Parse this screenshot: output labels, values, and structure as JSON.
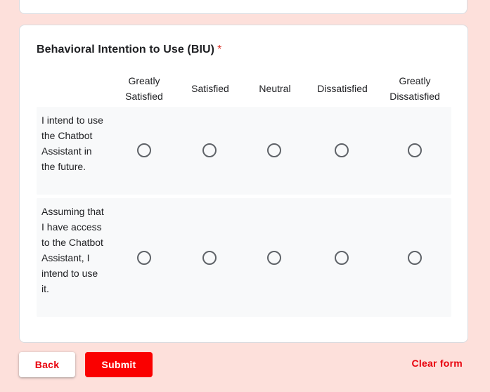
{
  "colors": {
    "page_background": "#fde0db",
    "card_background": "#ffffff",
    "row_background": "#f8f9fa",
    "required_asterisk": "#d93025",
    "accent": "#fa0000",
    "radio_border": "#5f6368"
  },
  "question": {
    "title": "Behavioral Intention to Use (BIU)",
    "required_marker": "*",
    "columns": [
      "Greatly Satisfied",
      "Satisfied",
      "Neutral",
      "Dissatisfied",
      "Greatly Dissatisfied"
    ],
    "rows": [
      {
        "label": "I intend to use the Chatbot Assistant in the future.",
        "selected": null
      },
      {
        "label": "Assuming that I have access to the Chatbot Assistant, I intend to use it.",
        "selected": null
      }
    ]
  },
  "footer": {
    "back_label": "Back",
    "submit_label": "Submit",
    "clear_label": "Clear form"
  }
}
